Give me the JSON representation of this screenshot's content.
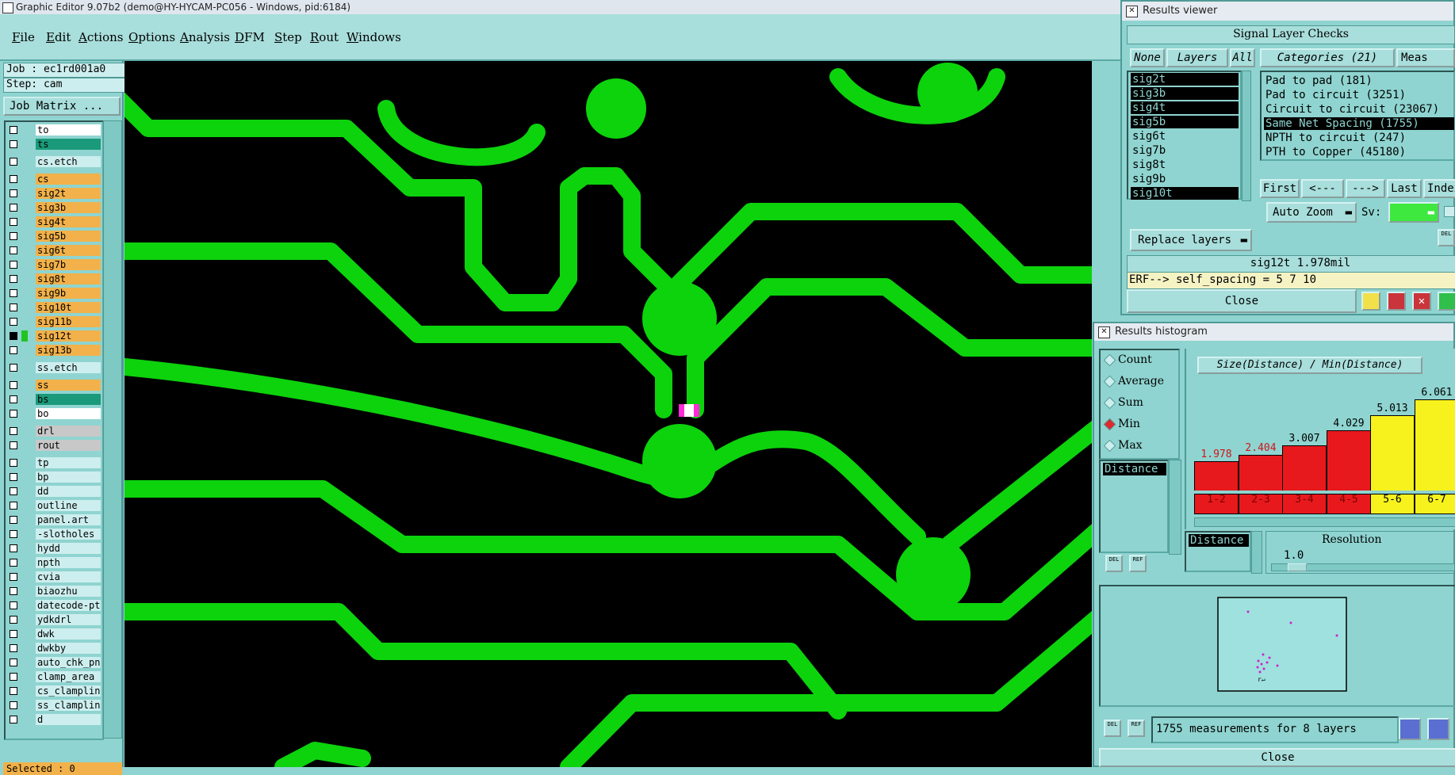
{
  "window": {
    "title": "Graphic Editor 9.07b2 (demo@HY-HYCAM-PC056 - Windows, pid:6184)"
  },
  "menu": [
    "File",
    "Edit",
    "Actions",
    "Options",
    "Analysis",
    "DFM",
    "Step",
    "Rout",
    "Windows"
  ],
  "left": {
    "job": "Job : ec1rd001a0",
    "step": "Step: cam",
    "job_matrix": "Job Matrix ...",
    "selected": "Selected : 0",
    "layers": [
      {
        "name": "to",
        "color": "#ffffff"
      },
      {
        "name": "ts",
        "color": "#1a9a7a"
      },
      {
        "name": "cs.etch",
        "color": "#cdeeee"
      },
      {
        "name": "cs",
        "color": "#f2b14a"
      },
      {
        "name": "sig2t",
        "color": "#f2b14a"
      },
      {
        "name": "sig3b",
        "color": "#f2b14a"
      },
      {
        "name": "sig4t",
        "color": "#f2b14a"
      },
      {
        "name": "sig5b",
        "color": "#f2b14a"
      },
      {
        "name": "sig6t",
        "color": "#f2b14a"
      },
      {
        "name": "sig7b",
        "color": "#f2b14a"
      },
      {
        "name": "sig8t",
        "color": "#f2b14a"
      },
      {
        "name": "sig9b",
        "color": "#f2b14a"
      },
      {
        "name": "sig10t",
        "color": "#f2b14a"
      },
      {
        "name": "sig11b",
        "color": "#f2b14a"
      },
      {
        "name": "sig12t",
        "color": "#f2b14a"
      },
      {
        "name": "sig13b",
        "color": "#f2b14a"
      },
      {
        "name": "ss.etch",
        "color": "#cdeeee"
      },
      {
        "name": "ss",
        "color": "#f2b14a"
      },
      {
        "name": "bs",
        "color": "#1a9a7a"
      },
      {
        "name": "bo",
        "color": "#ffffff"
      },
      {
        "name": "drl",
        "color": "#c8c8c8"
      },
      {
        "name": "rout",
        "color": "#c8c8c8"
      },
      {
        "name": "tp",
        "color": "#cdeeee"
      },
      {
        "name": "bp",
        "color": "#cdeeee"
      },
      {
        "name": "dd",
        "color": "#cdeeee"
      },
      {
        "name": "outline",
        "color": "#cdeeee"
      },
      {
        "name": "panel.art",
        "color": "#cdeeee"
      },
      {
        "name": "-slotholes",
        "color": "#cdeeee"
      },
      {
        "name": "hydd",
        "color": "#cdeeee"
      },
      {
        "name": "npth",
        "color": "#cdeeee"
      },
      {
        "name": "cvia",
        "color": "#cdeeee"
      },
      {
        "name": "biaozhu",
        "color": "#cdeeee"
      },
      {
        "name": "datecode-pt",
        "color": "#cdeeee"
      },
      {
        "name": "ydkdrl",
        "color": "#cdeeee"
      },
      {
        "name": "dwk",
        "color": "#cdeeee"
      },
      {
        "name": "dwkby",
        "color": "#cdeeee"
      },
      {
        "name": "auto_chk_pn",
        "color": "#cdeeee"
      },
      {
        "name": "clamp_area",
        "color": "#cdeeee"
      },
      {
        "name": "cs_clampline",
        "color": "#cdeeee"
      },
      {
        "name": "ss_clampline",
        "color": "#cdeeee"
      },
      {
        "name": "d",
        "color": "#cdeeee"
      }
    ]
  },
  "results_viewer": {
    "title": "Results viewer",
    "header": "Signal Layer Checks",
    "btn_none": "None",
    "btn_layers": "Layers",
    "btn_all": "All",
    "categories_hdr": "Categories (21)",
    "meas_hdr": "Meas",
    "layers": [
      "sig2t",
      "sig3b",
      "sig4t",
      "sig5b",
      "sig6t",
      "sig7b",
      "sig8t",
      "sig9b",
      "sig10t"
    ],
    "categories": [
      "Pad to pad (181)",
      "Pad to circuit (3251)",
      "Circuit to circuit (23067)",
      "Same Net Spacing (1755)",
      "NPTH to circuit (247)",
      "PTH to Copper (45180)"
    ],
    "nav": [
      "First",
      "<---",
      "--->",
      "Last",
      "Index"
    ],
    "auto_zoom": "Auto Zoom",
    "sv_label": "Sv:",
    "replace_layers": "Replace layers",
    "status1": "sig12t 1.978mil",
    "status2": "ERF--> self_spacing = 5 7 10",
    "close": "Close"
  },
  "histogram": {
    "title": "Results histogram",
    "modes": [
      "Count",
      "Average",
      "Sum",
      "Min",
      "Max"
    ],
    "selected_mode": "Min",
    "list_item": "Distance",
    "chart_title": "Size(Distance) / Min(Distance)",
    "resolution_label": "Resolution",
    "resolution_value": "1.0",
    "field2": "Distance",
    "summary": "1755 measurements for 8 layers",
    "close": "Close",
    "del": "DEL",
    "ref": "REF",
    "colors": {
      "low": "#e8191d",
      "high": "#f7f21d"
    }
  },
  "chart_data": {
    "type": "bar",
    "title": "Size(Distance) / Min(Distance)",
    "categories": [
      "1-2",
      "2-3",
      "3-4",
      "4-5",
      "5-6",
      "6-7"
    ],
    "values": [
      1.978,
      2.404,
      3.007,
      4.029,
      5.013,
      6.061
    ],
    "bar_colors": [
      "#e8191d",
      "#e8191d",
      "#e8191d",
      "#e8191d",
      "#f7f21d",
      "#f7f21d"
    ],
    "label_colors": [
      "#d0141a",
      "#d0141a",
      "#000000",
      "#000000",
      "#000000",
      "#000000"
    ],
    "ylim": [
      0,
      6.5
    ]
  }
}
